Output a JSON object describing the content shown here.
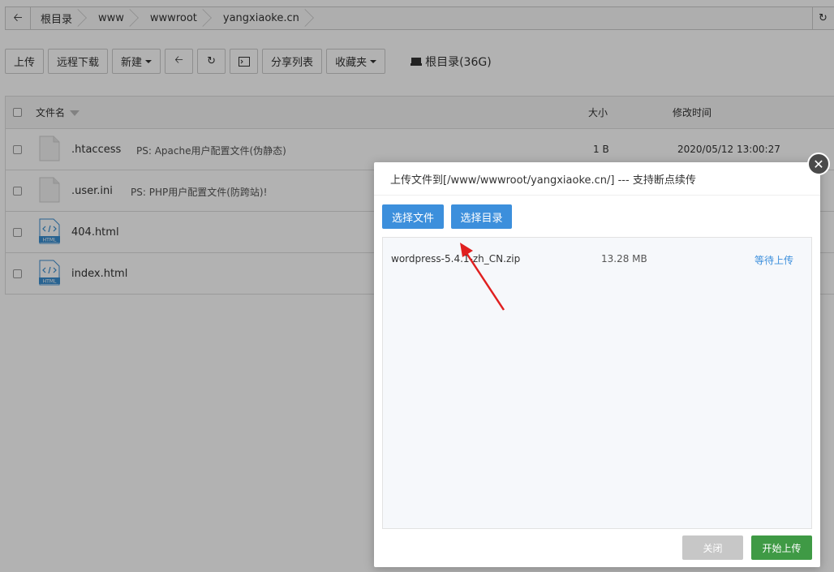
{
  "pathbar": {
    "crumbs": [
      "根目录",
      "www",
      "wwwroot",
      "yangxiaoke.cn"
    ]
  },
  "toolbar": {
    "upload": "上传",
    "remote_download": "远程下载",
    "new": "新建",
    "share_list": "分享列表",
    "favorites": "收藏夹",
    "disk": "根目录(36G)"
  },
  "table": {
    "headers": {
      "name": "文件名",
      "size": "大小",
      "modified": "修改时间"
    },
    "rows": [
      {
        "name": ".htaccess",
        "note": "PS: Apache用户配置文件(伪静态)",
        "size": "1 B",
        "modified": "2020/05/12 13:00:27",
        "icon": "file-icon"
      },
      {
        "name": ".user.ini",
        "note": "PS: PHP用户配置文件(防跨站)!",
        "size": "",
        "modified": "",
        "icon": "file-icon"
      },
      {
        "name": "404.html",
        "note": "",
        "size": "",
        "modified": "",
        "icon": "html-file-icon"
      },
      {
        "name": "index.html",
        "note": "",
        "size": "",
        "modified": "",
        "icon": "html-file-icon"
      }
    ]
  },
  "modal": {
    "title": "上传文件到[/www/wwwroot/yangxiaoke.cn/] --- 支持断点续传",
    "select_file": "选择文件",
    "select_dir": "选择目录",
    "file": {
      "name": "wordpress-5.4.1-zh_CN.zip",
      "size": "13.28 MB",
      "status": "等待上传"
    },
    "close": "关闭",
    "start": "开始上传"
  },
  "colors": {
    "primary": "#3c8fdc",
    "success": "#3f9a45",
    "annotation_arrow": "#e02020"
  }
}
